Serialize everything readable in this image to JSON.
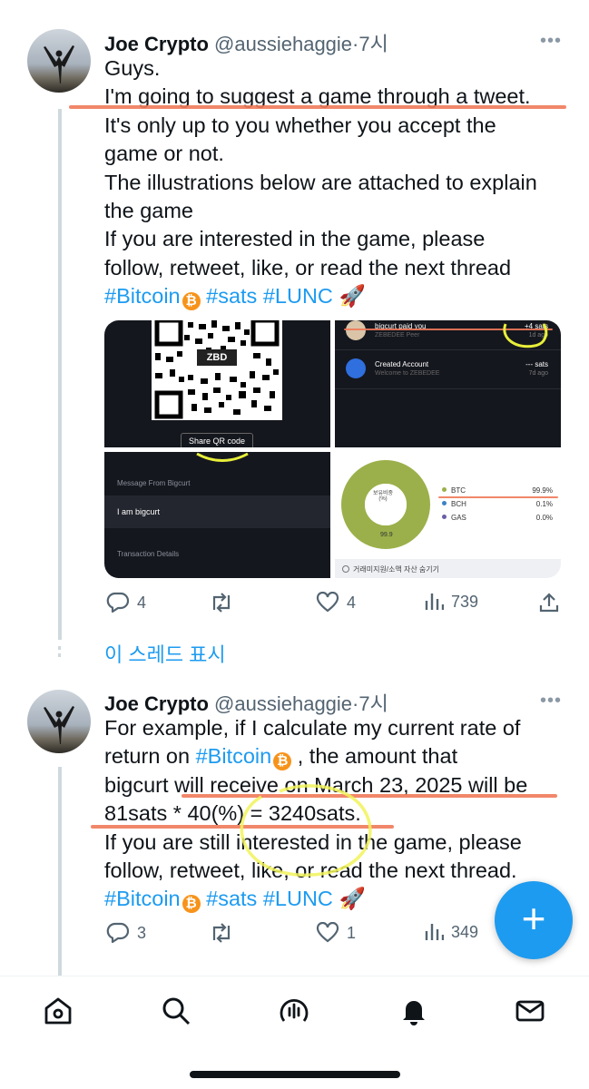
{
  "tweets": [
    {
      "name": "Joe Crypto",
      "handle": "@aussiehaggie",
      "dot": "·",
      "time": "7시",
      "more": "•••",
      "lines": [
        "Guys.",
        "I'm going to suggest a game through a tweet.",
        "It's only up to you whether you accept the",
        "game or not.",
        "The illustrations below are attached to explain",
        "the game",
        "If you are interested in the game, please",
        "follow, retweet, like, or read the next thread"
      ],
      "tags": [
        "#Bitcoin",
        "#sats",
        "#LUNC"
      ],
      "rocket": "🚀",
      "replies": "4",
      "likes": "4",
      "views": "739"
    },
    {
      "name": "Joe Crypto",
      "handle": "@aussiehaggie",
      "dot": "·",
      "time": "7시",
      "more": "•••",
      "line1": "For example, if I calculate my current rate of",
      "line2_pre": "return on ",
      "line2_tag": "#Bitcoin",
      "line2_post": " , the amount that",
      "line3": "bigcurt will receive on March 23, 2025 will be",
      "line4": "81sats * 40(%) = 3240sats.",
      "line5": "If you are still interested in the game, please",
      "line6": "follow, retweet, like, or read the next thread.",
      "tags": [
        "#Bitcoin",
        "#sats",
        "#LUNC"
      ],
      "rocket": "🚀",
      "replies": "3",
      "likes": "1",
      "views": "349"
    }
  ],
  "show_thread": "이 스레드 표시",
  "media": {
    "qr_logo": "ZBD",
    "share_qr": "Share QR code",
    "payment_title": "bigcurt paid you",
    "payment_sub": "ZEBEDEE Peer",
    "payment_amount": "+4 sats",
    "payment_date": "1d ago",
    "account_title": "Created Account",
    "account_sub": "Welcome to ZEBEDEE",
    "account_amount": "--- sats",
    "account_date": "7d ago",
    "message_label": "Message From Bigcurt",
    "message_text": "I am bigcurt",
    "transaction_label": "Transaction Details",
    "pie_center": "보유비중 (%)",
    "pie_value": "99.9",
    "holdings": [
      {
        "asset": "BTC",
        "pct": "99.9%",
        "color": "#9bb04a"
      },
      {
        "asset": "BCH",
        "pct": "0.1%",
        "color": "#3b82c4"
      },
      {
        "asset": "GAS",
        "pct": "0.0%",
        "color": "#6b5ea8"
      }
    ],
    "hide_label": "거래미지원/소액 자산 숨기기"
  }
}
